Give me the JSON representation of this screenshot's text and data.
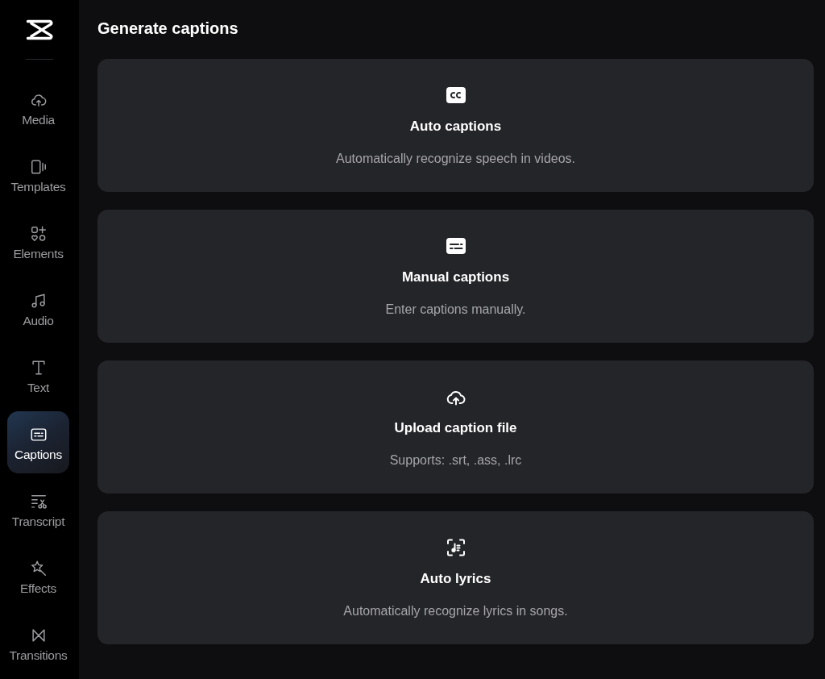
{
  "sidebar": {
    "items": [
      {
        "kind": "media",
        "label": "Media",
        "selected": false
      },
      {
        "kind": "templates",
        "label": "Templates",
        "selected": false
      },
      {
        "kind": "elements",
        "label": "Elements",
        "selected": false
      },
      {
        "kind": "audio",
        "label": "Audio",
        "selected": false
      },
      {
        "kind": "text",
        "label": "Text",
        "selected": false
      },
      {
        "kind": "captions",
        "label": "Captions",
        "selected": true
      },
      {
        "kind": "transcript",
        "label": "Transcript",
        "selected": false
      },
      {
        "kind": "effects",
        "label": "Effects",
        "selected": false
      },
      {
        "kind": "transitions",
        "label": "Transitions",
        "selected": false
      }
    ]
  },
  "main": {
    "title": "Generate captions",
    "options": [
      {
        "kind": "cc",
        "title": "Auto captions",
        "description": "Automatically recognize speech in videos."
      },
      {
        "kind": "caption-box",
        "title": "Manual captions",
        "description": "Enter captions manually."
      },
      {
        "kind": "cloud-upload",
        "title": "Upload caption file",
        "description": "Supports: .srt, .ass, .lrc"
      },
      {
        "kind": "lyrics",
        "title": "Auto lyrics",
        "description": "Automatically recognize lyrics in songs."
      }
    ]
  }
}
